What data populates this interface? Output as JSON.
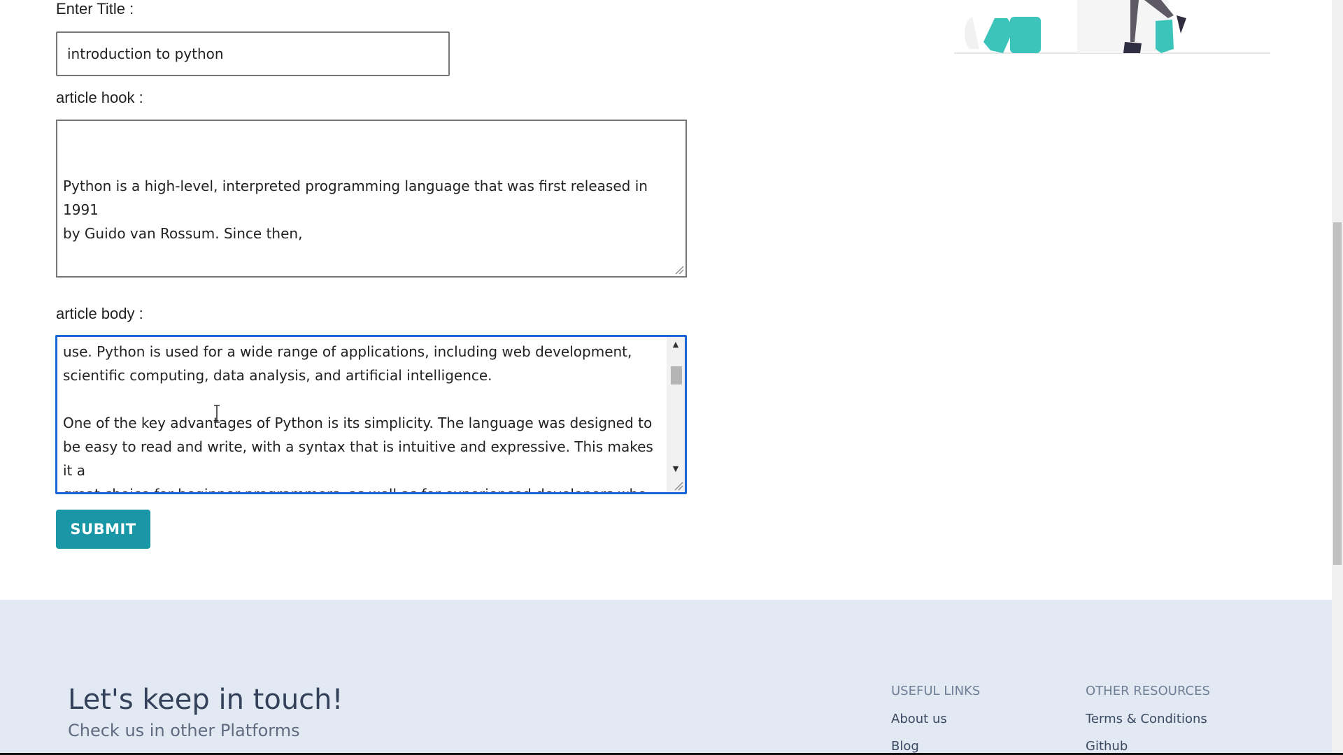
{
  "form": {
    "title_label": "Enter Title :",
    "title_value": "introduction to python",
    "hook_label": "article hook :",
    "hook_value": "Python is a high-level, interpreted programming language that was first released in 1991\nby Guido van Rossum. Since then,",
    "body_label": "article body :",
    "body_value": "use. Python is used for a wide range of applications, including web development,\nscientific computing, data analysis, and artificial intelligence.\n\nOne of the key advantages of Python is its simplicity. The language was designed to\nbe easy to read and write, with a syntax that is intuitive and expressive. This makes it a\ngreat choice for beginner programmers, as well as for experienced developers who\nwant to be more productive.",
    "submit_label": "SUBMIT"
  },
  "footer": {
    "heading": "Let's keep in touch!",
    "subheading": "Check us in other Platforms",
    "useful_links_title": "USEFUL LINKS",
    "useful_links": [
      "About us",
      "Blog"
    ],
    "other_resources_title": "OTHER RESOURCES",
    "other_resources": [
      "Terms & Conditions",
      "Github"
    ]
  },
  "colors": {
    "accent_button": "#1a97a6",
    "focus_border": "#1a66d9",
    "footer_bg": "#e3e9f2",
    "illustration_teal": "#3cc4bb"
  }
}
